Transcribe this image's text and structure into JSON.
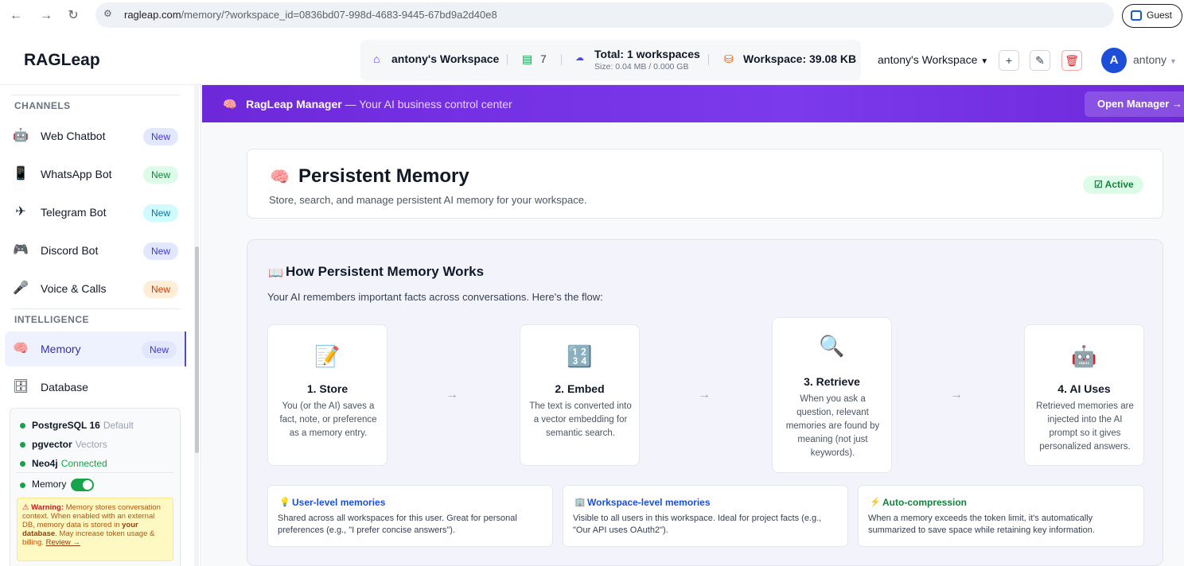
{
  "browser": {
    "url_host": "ragleap.com",
    "url_path": "/memory/?workspace_id=0836bd07-998d-4683-9445-67bd9a2d40e8",
    "guest_label": "Guest"
  },
  "header": {
    "brand": "RAGLeap",
    "workspace_name": "antony's Workspace",
    "doc_count": "7",
    "total_label": "Total: 1 workspaces",
    "size_label": "Size: 0.04 MB / 0.000 GB",
    "workspace_size": "Workspace: 39.08 KB",
    "selector_label": "antony's Workspace",
    "avatar_initial": "A",
    "username": "antony"
  },
  "sidebar": {
    "channels_heading": "CHANNELS",
    "intelligence_heading": "INTELLIGENCE",
    "channels": [
      {
        "label": "Web Chatbot",
        "badge": "New",
        "icon": "robot-icon"
      },
      {
        "label": "WhatsApp Bot",
        "badge": "New",
        "icon": "phone-icon"
      },
      {
        "label": "Telegram Bot",
        "badge": "New",
        "icon": "plane-icon"
      },
      {
        "label": "Discord Bot",
        "badge": "New",
        "icon": "gamepad-icon"
      },
      {
        "label": "Voice & Calls",
        "badge": "New",
        "icon": "microphone-icon"
      }
    ],
    "intelligence": [
      {
        "label": "Memory",
        "badge": "New",
        "icon": "brain-icon"
      },
      {
        "label": "Database",
        "icon": "database-icon"
      }
    ],
    "db": {
      "postgres": "PostgreSQL 16",
      "postgres_note": "Default",
      "pgvector": "pgvector",
      "pgvector_note": "Vectors",
      "neo4j": "Neo4j",
      "neo4j_note": "Connected",
      "memory_label": "Memory",
      "memory_enabled": true,
      "warning_title": "Warning:",
      "warning_text1": " Memory stores conversation context. When enabled with an external DB, memory data is stored in ",
      "warning_bold": "your database",
      "warning_text2": ". May increase token usage & billing. ",
      "warning_link": "Review →"
    }
  },
  "banner": {
    "title": "RagLeap Manager",
    "subtitle": " — Your AI business control center",
    "button": "Open Manager →"
  },
  "memory": {
    "title": "Persistent Memory",
    "subtitle": "Store, search, and manage persistent AI memory for your workspace.",
    "status": "Active"
  },
  "how": {
    "title": "How Persistent Memory Works",
    "subtitle": "Your AI remembers important facts across conversations. Here's the flow:",
    "arrow": "→",
    "steps": [
      {
        "title": "1. Store",
        "desc": "You (or the AI) saves a fact, note, or preference as a memory entry.",
        "icon": "memo-icon"
      },
      {
        "title": "2. Embed",
        "desc": "The text is converted into a vector embedding for semantic search.",
        "icon": "numbers-icon"
      },
      {
        "title": "3. Retrieve",
        "desc": "When you ask a question, relevant memories are found by meaning (not just keywords).",
        "icon": "magnifier-icon"
      },
      {
        "title": "4. AI Uses",
        "desc": "Retrieved memories are injected into the AI prompt so it gives personalized answers.",
        "icon": "robot-icon"
      }
    ],
    "info": [
      {
        "title": "User-level memories",
        "desc": "Shared across all workspaces for this user. Great for personal preferences (e.g., \"I prefer concise answers\").",
        "color": "#1d4ed8"
      },
      {
        "title": "Workspace-level memories",
        "desc": "Visible to all users in this workspace. Ideal for project facts (e.g., \"Our API uses OAuth2\").",
        "color": "#1d4ed8"
      },
      {
        "title": "Auto-compression",
        "desc": "When a memory exceeds the token limit, it's automatically summarized to save space while retaining key information.",
        "color": "#15803d"
      }
    ]
  }
}
